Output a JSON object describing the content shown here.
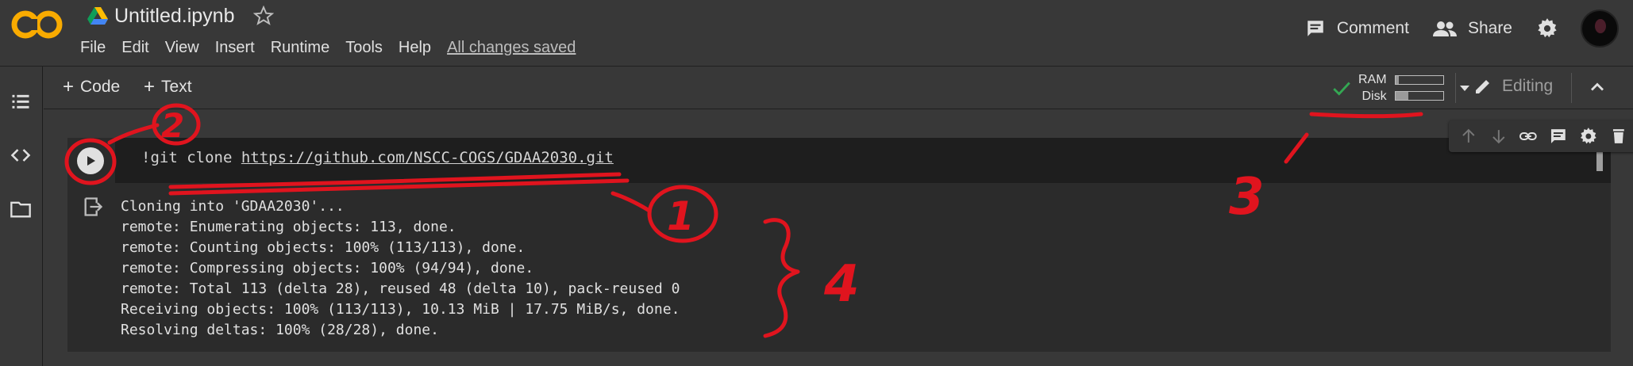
{
  "header": {
    "logo_text": "CO",
    "doc_title": "Untitled.ipynb",
    "menu": [
      "File",
      "Edit",
      "View",
      "Insert",
      "Runtime",
      "Tools",
      "Help"
    ],
    "save_status": "All changes saved",
    "comment_label": "Comment",
    "share_label": "Share"
  },
  "toolbar": {
    "code_label": "Code",
    "text_label": "Text",
    "ram_label": "RAM",
    "disk_label": "Disk",
    "ram_usage": 0.08,
    "disk_usage": 0.28,
    "editing_label": "Editing"
  },
  "cell": {
    "code_prefix": "!git clone ",
    "code_url": "https://github.com/NSCC-COGS/GDAA2030.git",
    "output": [
      "Cloning into 'GDAA2030'...",
      "remote: Enumerating objects: 113, done.",
      "remote: Counting objects: 100% (113/113), done.",
      "remote: Compressing objects: 100% (94/94), done.",
      "remote: Total 113 (delta 28), reused 48 (delta 10), pack-reused 0",
      "Receiving objects: 100% (113/113), 10.13 MiB | 17.75 MiB/s, done.",
      "Resolving deltas: 100% (28/28), done."
    ]
  },
  "annotations": {
    "mark_1": "1",
    "mark_2": "2",
    "mark_3": "3",
    "mark_4": "4"
  },
  "colors": {
    "annotation_red": "#e0141e",
    "logo_orange": "#f9ab00",
    "check_green": "#34a853"
  }
}
